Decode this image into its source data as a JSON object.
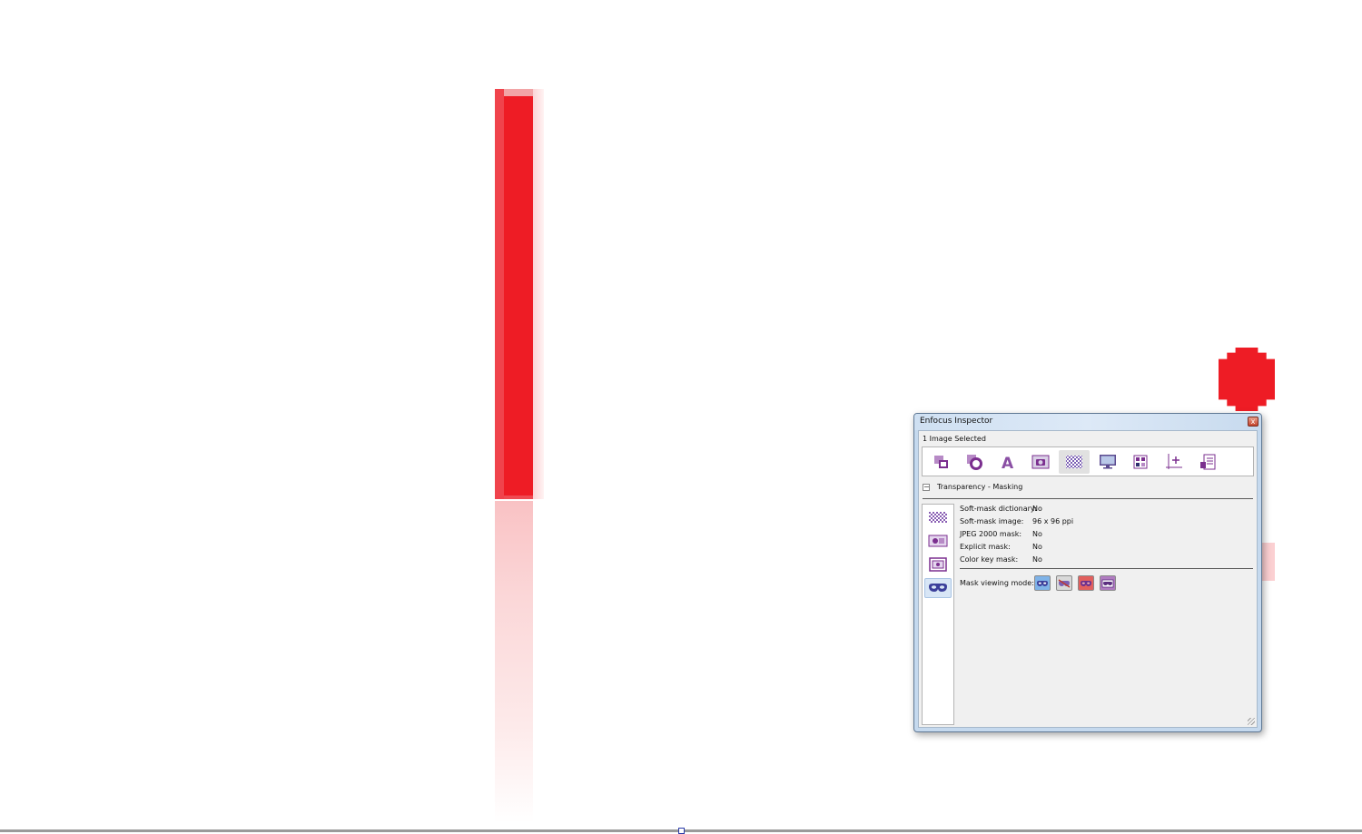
{
  "inspector": {
    "title": "Enfocus Inspector",
    "close_glyph": "x",
    "selection_status": "1 Image Selected",
    "toolbar": [
      {
        "icon": "object-arrange-icon",
        "active": false
      },
      {
        "icon": "shape-icon",
        "active": false
      },
      {
        "icon": "text-icon",
        "glyph": "A",
        "active": false
      },
      {
        "icon": "image-camera-icon",
        "active": false
      },
      {
        "icon": "transparency-icon",
        "active": true
      },
      {
        "icon": "monitor-icon",
        "active": false
      },
      {
        "icon": "layout-icon",
        "active": false
      },
      {
        "icon": "position-axis-icon",
        "active": false
      },
      {
        "icon": "info-icon",
        "active": false
      }
    ],
    "section": {
      "collapse_glyph": "−",
      "title": "Transparency - Masking"
    },
    "side_tabs": [
      {
        "icon": "soft-mask-icon",
        "active": false
      },
      {
        "icon": "image-mask-icon",
        "active": false
      },
      {
        "icon": "frame-mask-icon",
        "active": false
      },
      {
        "icon": "mask-view-icon",
        "active": true
      }
    ],
    "properties": [
      {
        "label": "Soft-mask dictionary:",
        "value": "No"
      },
      {
        "label": "Soft-mask image:",
        "value": "96 x 96 ppi"
      },
      {
        "label": "JPEG 2000 mask:",
        "value": "No"
      },
      {
        "label": "Explicit mask:",
        "value": "No"
      },
      {
        "label": "Color key mask:",
        "value": "No"
      }
    ],
    "mask_viewing_mode": {
      "label": "Mask viewing mode:",
      "buttons": [
        {
          "icon": "mask-normal-icon",
          "color": "#7fb3e8"
        },
        {
          "icon": "mask-off-icon",
          "color": "#d9d9d9"
        },
        {
          "icon": "mask-red-icon",
          "color": "#e2605e"
        },
        {
          "icon": "mask-outline-icon",
          "color": "#b07cc0"
        }
      ]
    }
  },
  "colors": {
    "artwork_red": "#ee1c25",
    "icon_purple": "#7b2f8f",
    "accent_blue": "#3b5bdb"
  }
}
